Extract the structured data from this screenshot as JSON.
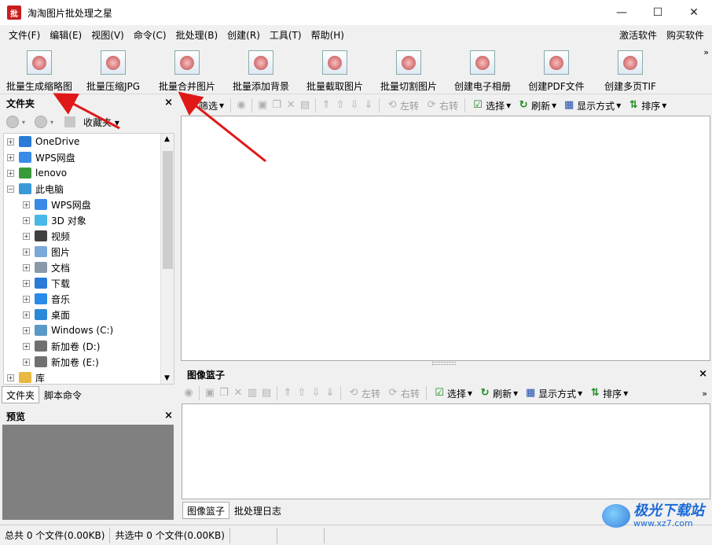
{
  "window": {
    "title": "淘淘图片批处理之星",
    "app_icon_text": "批",
    "minimize": "—",
    "maximize": "☐",
    "close": "✕"
  },
  "menu": {
    "items": [
      "文件(F)",
      "编辑(E)",
      "视图(V)",
      "命令(C)",
      "批处理(B)",
      "创建(R)",
      "工具(T)",
      "帮助(H)"
    ],
    "right": [
      "激活软件",
      "购买软件"
    ]
  },
  "toolbar": {
    "items": [
      {
        "label": "批量生成缩略图",
        "icon": "thumbnail-icon"
      },
      {
        "label": "批量压缩JPG",
        "icon": "compress-jpg-icon"
      },
      {
        "label": "批量合并图片",
        "icon": "merge-icon"
      },
      {
        "label": "批量添加背景",
        "icon": "background-icon"
      },
      {
        "label": "批量截取图片",
        "icon": "crop-icon"
      },
      {
        "label": "批量切割图片",
        "icon": "split-icon"
      },
      {
        "label": "创建电子相册",
        "icon": "album-icon"
      },
      {
        "label": "创建PDF文件",
        "icon": "pdf-icon"
      },
      {
        "label": "创建多页TIF",
        "icon": "tif-icon"
      }
    ],
    "more": "»"
  },
  "folder_pane": {
    "title": "文件夹",
    "close": "×",
    "favorites_label": "收藏夹",
    "tree": [
      {
        "label": "OneDrive",
        "level": 0,
        "expander": "+",
        "icon": "cloud-icon",
        "color": "#2a7ad8"
      },
      {
        "label": "WPS网盘",
        "level": 0,
        "expander": "+",
        "icon": "cloud-icon",
        "color": "#3a8ae8"
      },
      {
        "label": "lenovo",
        "level": 0,
        "expander": "+",
        "icon": "user-icon",
        "color": "#3a9a3a"
      },
      {
        "label": "此电脑",
        "level": 0,
        "expander": "−",
        "icon": "computer-icon",
        "color": "#3a9ad8"
      },
      {
        "label": "WPS网盘",
        "level": 1,
        "expander": "+",
        "icon": "cloud-icon",
        "color": "#3a8ae8"
      },
      {
        "label": "3D 对象",
        "level": 1,
        "expander": "+",
        "icon": "cube-icon",
        "color": "#48b8e8"
      },
      {
        "label": "视频",
        "level": 1,
        "expander": "+",
        "icon": "video-icon",
        "color": "#404040"
      },
      {
        "label": "图片",
        "level": 1,
        "expander": "+",
        "icon": "picture-icon",
        "color": "#7aa8d8"
      },
      {
        "label": "文档",
        "level": 1,
        "expander": "+",
        "icon": "document-icon",
        "color": "#8a98a8"
      },
      {
        "label": "下载",
        "level": 1,
        "expander": "+",
        "icon": "download-icon",
        "color": "#2a7ad8"
      },
      {
        "label": "音乐",
        "level": 1,
        "expander": "+",
        "icon": "music-icon",
        "color": "#2a8ae8"
      },
      {
        "label": "桌面",
        "level": 1,
        "expander": "+",
        "icon": "desktop-icon",
        "color": "#2a8ad8"
      },
      {
        "label": "Windows (C:)",
        "level": 1,
        "expander": "+",
        "icon": "drive-icon",
        "color": "#5a98c8"
      },
      {
        "label": "新加卷 (D:)",
        "level": 1,
        "expander": "+",
        "icon": "drive-icon",
        "color": "#707070"
      },
      {
        "label": "新加卷 (E:)",
        "level": 1,
        "expander": "+",
        "icon": "drive-icon",
        "color": "#707070"
      },
      {
        "label": "库",
        "level": 0,
        "expander": "+",
        "icon": "library-icon",
        "color": "#e8b840"
      }
    ],
    "tabs": [
      "文件夹",
      "脚本命令"
    ]
  },
  "preview_pane": {
    "title": "预览",
    "close": "×"
  },
  "main_toolbar": {
    "filter": "筛选",
    "rotate_left": "左转",
    "rotate_right": "右转",
    "select": "选择",
    "refresh": "刷新",
    "display_mode": "显示方式",
    "sort": "排序"
  },
  "basket": {
    "title": "图像篮子",
    "close": "×",
    "more": "»",
    "rotate_left": "左转",
    "rotate_right": "右转",
    "select": "选择",
    "refresh": "刷新",
    "display_mode": "显示方式",
    "sort": "排序",
    "tabs": [
      "图像篮子",
      "批处理日志"
    ]
  },
  "status": {
    "total": "总共 0 个文件(0.00KB)",
    "selected": "共选中 0 个文件(0.00KB)"
  },
  "watermark": {
    "name": "极光下载站",
    "url": "www.xz7.com"
  },
  "colors": {
    "arrow": "#e01818",
    "accent": "#1a6ad8"
  }
}
